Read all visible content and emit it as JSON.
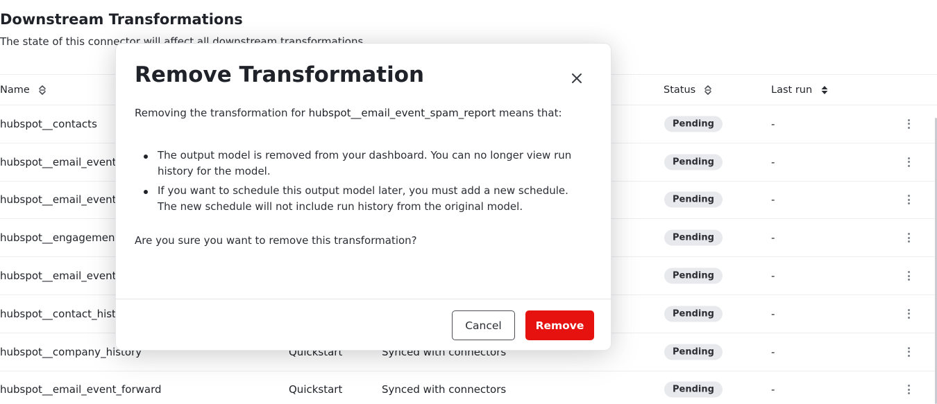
{
  "section": {
    "title": "Downstream Transformations",
    "subtitle": "The state of this connector will affect all downstream transformations"
  },
  "table": {
    "columns": {
      "name": "Name",
      "status": "Status",
      "last_run": "Last run"
    },
    "rows": [
      {
        "name": "hubspot__contacts",
        "type": "",
        "schedule": "",
        "status": "Pending",
        "last_run": "-"
      },
      {
        "name": "hubspot__email_event_",
        "type": "",
        "schedule": "",
        "status": "Pending",
        "last_run": "-"
      },
      {
        "name": "hubspot__email_event_",
        "type": "",
        "schedule": "",
        "status": "Pending",
        "last_run": "-"
      },
      {
        "name": "hubspot__engagement",
        "type": "",
        "schedule": "",
        "status": "Pending",
        "last_run": "-"
      },
      {
        "name": "hubspot__email_event_",
        "type": "",
        "schedule": "",
        "status": "Pending",
        "last_run": "-"
      },
      {
        "name": "hubspot__contact_histo",
        "type": "",
        "schedule": "",
        "status": "Pending",
        "last_run": "-"
      },
      {
        "name": "hubspot__company_history",
        "type": "Quickstart",
        "schedule": "Synced with connectors",
        "status": "Pending",
        "last_run": "-"
      },
      {
        "name": "hubspot__email_event_forward",
        "type": "Quickstart",
        "schedule": "Synced with connectors",
        "status": "Pending",
        "last_run": "-"
      }
    ]
  },
  "modal": {
    "title": "Remove Transformation",
    "intro_prefix": "Removing the transformation for ",
    "intro_model": "hubspot__email_event_spam_report",
    "intro_suffix": " means that:",
    "bullets": [
      "The output model is removed from your dashboard. You can no longer view run history for the model.",
      "If you want to schedule this output model later, you must add a new schedule. The new schedule will not include run history from the original model."
    ],
    "question": "Are you sure you want to remove this transformation?",
    "cancel_label": "Cancel",
    "remove_label": "Remove"
  },
  "colors": {
    "remove_button": "#e5120f",
    "badge_background": "#e8e9ec"
  },
  "icons": {
    "sort": "sort-icon",
    "sort_active": "sort-active-icon",
    "close": "close-icon",
    "row_menu": "kebab-menu-icon"
  }
}
